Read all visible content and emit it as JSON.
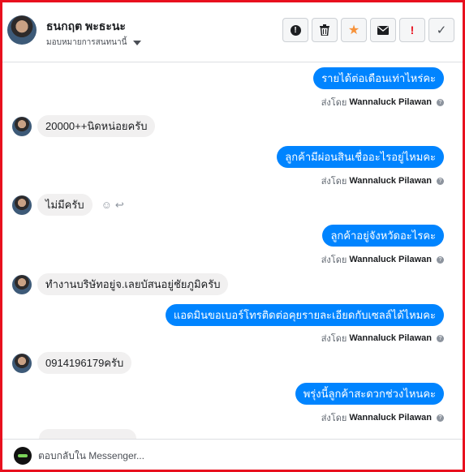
{
  "header": {
    "name": "ธนกฤต พะธะนะ",
    "assign_label": "มอบหมายการสนทนานี้",
    "actions": [
      {
        "icon": "alert-circle-icon",
        "glyph": "●"
      },
      {
        "icon": "trash-icon",
        "glyph": "🗑"
      },
      {
        "icon": "star-icon",
        "glyph": "★"
      },
      {
        "icon": "envelope-icon",
        "glyph": "✉"
      },
      {
        "icon": "exclamation-icon",
        "glyph": "!"
      },
      {
        "icon": "check-icon",
        "glyph": "✓"
      }
    ]
  },
  "sent_by": {
    "prefix": "ส่งโดย",
    "agent": "Wannaluck Pilawan",
    "info_glyph": "?"
  },
  "messages": [
    {
      "dir": "out",
      "text": "รายได้ต่อเดือนเท่าไหร่คะ"
    },
    {
      "dir": "in",
      "text": "20000++นิดหน่อยครับ"
    },
    {
      "dir": "out",
      "text": "ลูกค้ามีผ่อนสินเชื่ออะไรอยู่ไหมคะ"
    },
    {
      "dir": "in",
      "text": "ไม่มีครับ"
    },
    {
      "dir": "out",
      "text": "ลูกค้าอยู่จังหวัดอะไรคะ"
    },
    {
      "dir": "in",
      "text": "ทำงานบริษัทอยู่จ.เลยบัสนอยู่ชัยภูมิครับ"
    },
    {
      "dir": "out",
      "text": "แอดมินขอเบอร์โทรติดต่อคุยรายละเอียดกับเซลล์ได้ไหมคะ"
    },
    {
      "dir": "in",
      "text": "0914196179ครับ"
    },
    {
      "dir": "out",
      "text": "พรุ่งนี้ลูกค้าสะดวกช่วงไหนคะ"
    }
  ],
  "reactions": {
    "smile_glyph": "☺",
    "reply_glyph": "↩"
  },
  "composer": {
    "placeholder": "ตอบกลับใน Messenger..."
  },
  "colors": {
    "accent": "#0084ff",
    "star": "#f7923a",
    "alert": "#e8101e",
    "border": "#e8101e"
  }
}
